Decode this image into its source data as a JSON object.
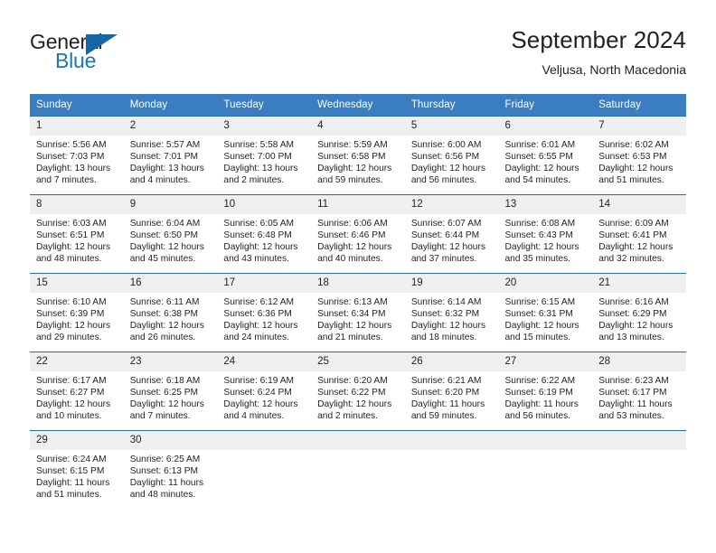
{
  "brand": {
    "word1": "General",
    "word2": "Blue",
    "accent_color": "#1b73b8",
    "triangle_icon": "brand-triangle-icon"
  },
  "header": {
    "title": "September 2024",
    "subtitle": "Veljusa, North Macedonia"
  },
  "calendar": {
    "header_bg": "#3a7dc0",
    "weekday_headers": [
      "Sunday",
      "Monday",
      "Tuesday",
      "Wednesday",
      "Thursday",
      "Friday",
      "Saturday"
    ],
    "weeks": [
      [
        {
          "day": "1",
          "sunrise": "Sunrise: 5:56 AM",
          "sunset": "Sunset: 7:03 PM",
          "daylight1": "Daylight: 13 hours",
          "daylight2": "and 7 minutes."
        },
        {
          "day": "2",
          "sunrise": "Sunrise: 5:57 AM",
          "sunset": "Sunset: 7:01 PM",
          "daylight1": "Daylight: 13 hours",
          "daylight2": "and 4 minutes."
        },
        {
          "day": "3",
          "sunrise": "Sunrise: 5:58 AM",
          "sunset": "Sunset: 7:00 PM",
          "daylight1": "Daylight: 13 hours",
          "daylight2": "and 2 minutes."
        },
        {
          "day": "4",
          "sunrise": "Sunrise: 5:59 AM",
          "sunset": "Sunset: 6:58 PM",
          "daylight1": "Daylight: 12 hours",
          "daylight2": "and 59 minutes."
        },
        {
          "day": "5",
          "sunrise": "Sunrise: 6:00 AM",
          "sunset": "Sunset: 6:56 PM",
          "daylight1": "Daylight: 12 hours",
          "daylight2": "and 56 minutes."
        },
        {
          "day": "6",
          "sunrise": "Sunrise: 6:01 AM",
          "sunset": "Sunset: 6:55 PM",
          "daylight1": "Daylight: 12 hours",
          "daylight2": "and 54 minutes."
        },
        {
          "day": "7",
          "sunrise": "Sunrise: 6:02 AM",
          "sunset": "Sunset: 6:53 PM",
          "daylight1": "Daylight: 12 hours",
          "daylight2": "and 51 minutes."
        }
      ],
      [
        {
          "day": "8",
          "sunrise": "Sunrise: 6:03 AM",
          "sunset": "Sunset: 6:51 PM",
          "daylight1": "Daylight: 12 hours",
          "daylight2": "and 48 minutes."
        },
        {
          "day": "9",
          "sunrise": "Sunrise: 6:04 AM",
          "sunset": "Sunset: 6:50 PM",
          "daylight1": "Daylight: 12 hours",
          "daylight2": "and 45 minutes."
        },
        {
          "day": "10",
          "sunrise": "Sunrise: 6:05 AM",
          "sunset": "Sunset: 6:48 PM",
          "daylight1": "Daylight: 12 hours",
          "daylight2": "and 43 minutes."
        },
        {
          "day": "11",
          "sunrise": "Sunrise: 6:06 AM",
          "sunset": "Sunset: 6:46 PM",
          "daylight1": "Daylight: 12 hours",
          "daylight2": "and 40 minutes."
        },
        {
          "day": "12",
          "sunrise": "Sunrise: 6:07 AM",
          "sunset": "Sunset: 6:44 PM",
          "daylight1": "Daylight: 12 hours",
          "daylight2": "and 37 minutes."
        },
        {
          "day": "13",
          "sunrise": "Sunrise: 6:08 AM",
          "sunset": "Sunset: 6:43 PM",
          "daylight1": "Daylight: 12 hours",
          "daylight2": "and 35 minutes."
        },
        {
          "day": "14",
          "sunrise": "Sunrise: 6:09 AM",
          "sunset": "Sunset: 6:41 PM",
          "daylight1": "Daylight: 12 hours",
          "daylight2": "and 32 minutes."
        }
      ],
      [
        {
          "day": "15",
          "sunrise": "Sunrise: 6:10 AM",
          "sunset": "Sunset: 6:39 PM",
          "daylight1": "Daylight: 12 hours",
          "daylight2": "and 29 minutes."
        },
        {
          "day": "16",
          "sunrise": "Sunrise: 6:11 AM",
          "sunset": "Sunset: 6:38 PM",
          "daylight1": "Daylight: 12 hours",
          "daylight2": "and 26 minutes."
        },
        {
          "day": "17",
          "sunrise": "Sunrise: 6:12 AM",
          "sunset": "Sunset: 6:36 PM",
          "daylight1": "Daylight: 12 hours",
          "daylight2": "and 24 minutes."
        },
        {
          "day": "18",
          "sunrise": "Sunrise: 6:13 AM",
          "sunset": "Sunset: 6:34 PM",
          "daylight1": "Daylight: 12 hours",
          "daylight2": "and 21 minutes."
        },
        {
          "day": "19",
          "sunrise": "Sunrise: 6:14 AM",
          "sunset": "Sunset: 6:32 PM",
          "daylight1": "Daylight: 12 hours",
          "daylight2": "and 18 minutes."
        },
        {
          "day": "20",
          "sunrise": "Sunrise: 6:15 AM",
          "sunset": "Sunset: 6:31 PM",
          "daylight1": "Daylight: 12 hours",
          "daylight2": "and 15 minutes."
        },
        {
          "day": "21",
          "sunrise": "Sunrise: 6:16 AM",
          "sunset": "Sunset: 6:29 PM",
          "daylight1": "Daylight: 12 hours",
          "daylight2": "and 13 minutes."
        }
      ],
      [
        {
          "day": "22",
          "sunrise": "Sunrise: 6:17 AM",
          "sunset": "Sunset: 6:27 PM",
          "daylight1": "Daylight: 12 hours",
          "daylight2": "and 10 minutes."
        },
        {
          "day": "23",
          "sunrise": "Sunrise: 6:18 AM",
          "sunset": "Sunset: 6:25 PM",
          "daylight1": "Daylight: 12 hours",
          "daylight2": "and 7 minutes."
        },
        {
          "day": "24",
          "sunrise": "Sunrise: 6:19 AM",
          "sunset": "Sunset: 6:24 PM",
          "daylight1": "Daylight: 12 hours",
          "daylight2": "and 4 minutes."
        },
        {
          "day": "25",
          "sunrise": "Sunrise: 6:20 AM",
          "sunset": "Sunset: 6:22 PM",
          "daylight1": "Daylight: 12 hours",
          "daylight2": "and 2 minutes."
        },
        {
          "day": "26",
          "sunrise": "Sunrise: 6:21 AM",
          "sunset": "Sunset: 6:20 PM",
          "daylight1": "Daylight: 11 hours",
          "daylight2": "and 59 minutes."
        },
        {
          "day": "27",
          "sunrise": "Sunrise: 6:22 AM",
          "sunset": "Sunset: 6:19 PM",
          "daylight1": "Daylight: 11 hours",
          "daylight2": "and 56 minutes."
        },
        {
          "day": "28",
          "sunrise": "Sunrise: 6:23 AM",
          "sunset": "Sunset: 6:17 PM",
          "daylight1": "Daylight: 11 hours",
          "daylight2": "and 53 minutes."
        }
      ],
      [
        {
          "day": "29",
          "sunrise": "Sunrise: 6:24 AM",
          "sunset": "Sunset: 6:15 PM",
          "daylight1": "Daylight: 11 hours",
          "daylight2": "and 51 minutes."
        },
        {
          "day": "30",
          "sunrise": "Sunrise: 6:25 AM",
          "sunset": "Sunset: 6:13 PM",
          "daylight1": "Daylight: 11 hours",
          "daylight2": "and 48 minutes."
        },
        {
          "day": "",
          "sunrise": "",
          "sunset": "",
          "daylight1": "",
          "daylight2": ""
        },
        {
          "day": "",
          "sunrise": "",
          "sunset": "",
          "daylight1": "",
          "daylight2": ""
        },
        {
          "day": "",
          "sunrise": "",
          "sunset": "",
          "daylight1": "",
          "daylight2": ""
        },
        {
          "day": "",
          "sunrise": "",
          "sunset": "",
          "daylight1": "",
          "daylight2": ""
        },
        {
          "day": "",
          "sunrise": "",
          "sunset": "",
          "daylight1": "",
          "daylight2": ""
        }
      ]
    ]
  }
}
